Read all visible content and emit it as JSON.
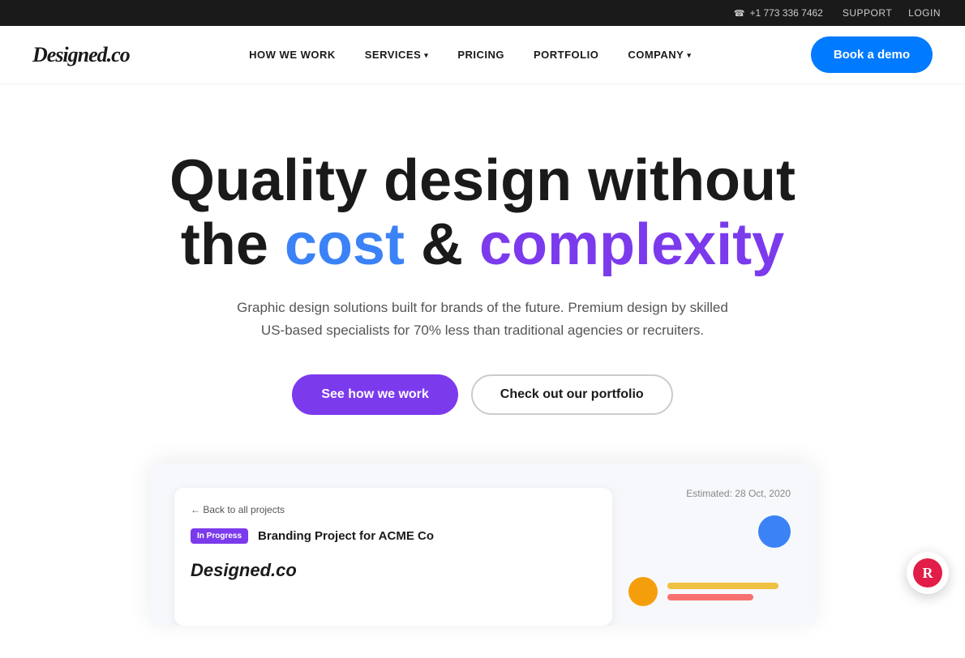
{
  "topbar": {
    "phone": "+1 773 336 7462",
    "phone_icon": "☎",
    "links": [
      {
        "label": "SUPPORT",
        "href": "#"
      },
      {
        "label": "LOGIN",
        "href": "#"
      }
    ]
  },
  "header": {
    "logo": "Designed.co",
    "nav_items": [
      {
        "label": "HOW WE WORK",
        "has_dropdown": false
      },
      {
        "label": "SERVICES",
        "has_dropdown": true
      },
      {
        "label": "PRICING",
        "has_dropdown": false
      },
      {
        "label": "PORTFOLIO",
        "has_dropdown": false
      },
      {
        "label": "COMPANY",
        "has_dropdown": true
      }
    ],
    "cta_label": "Book a demo"
  },
  "hero": {
    "title_part1": "Quality design without",
    "title_part2_pre": "the ",
    "title_cost": "cost",
    "title_mid": " & ",
    "title_complexity": "complexity",
    "subtitle": "Graphic design solutions built for brands of the future. Premium design by skilled US-based specialists for 70% less than traditional agencies or recruiters.",
    "btn_primary": "See how we work",
    "btn_secondary": "Check out our portfolio"
  },
  "dashboard": {
    "back_link": "← Back to all projects",
    "badge": "In Progress",
    "project_title": "Branding Project for ACME Co",
    "estimated": "Estimated: 28 Oct, 2020",
    "logo_text": "Designed.co"
  },
  "colors": {
    "primary_blue": "#007bff",
    "purple": "#7c3aed",
    "blue_accent": "#3b82f6",
    "yellow": "#f59e0b"
  }
}
